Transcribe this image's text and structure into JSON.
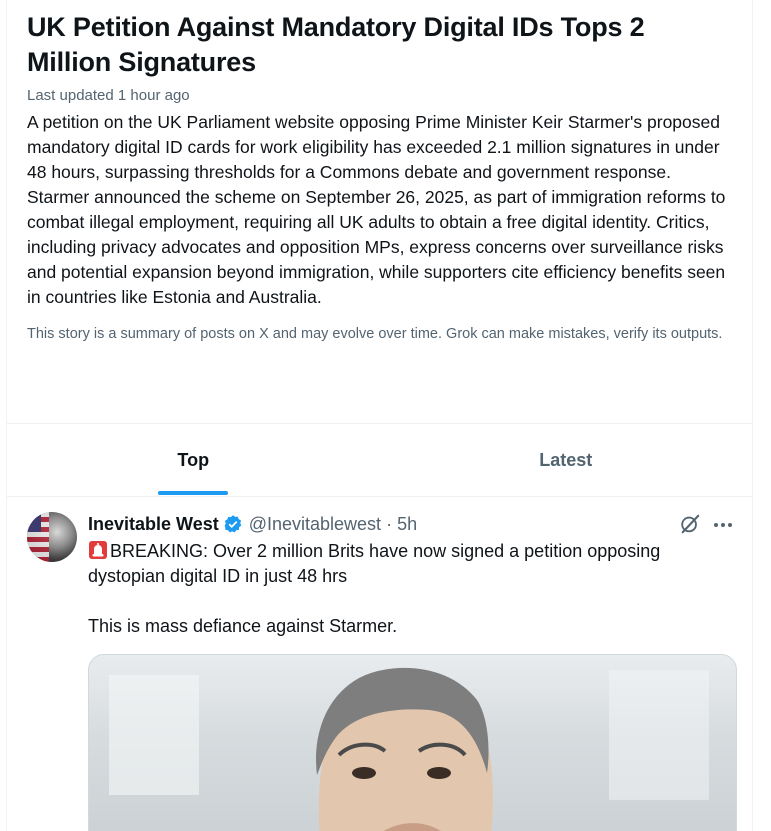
{
  "story": {
    "title": "UK Petition Against Mandatory Digital IDs Tops 2 Million Signatures",
    "updated": "Last updated 1 hour ago",
    "body": "A petition on the UK Parliament website opposing Prime Minister Keir Starmer's proposed mandatory digital ID cards for work eligibility has exceeded 2.1 million signatures in under 48 hours, surpassing thresholds for a Commons debate and government response. Starmer announced the scheme on September 26, 2025, as part of immigration reforms to combat illegal employment, requiring all UK adults to obtain a free digital identity. Critics, including privacy advocates and opposition MPs, express concerns over surveillance risks and potential expansion beyond immigration, while supporters cite efficiency benefits seen in countries like Estonia and Australia.",
    "disclaimer": "This story is a summary of posts on X and may evolve over time. Grok can make mistakes, verify its outputs."
  },
  "tabs": [
    {
      "label": "Top",
      "active": true
    },
    {
      "label": "Latest",
      "active": false
    }
  ],
  "post": {
    "author": "Inevitable West",
    "handle": "@Inevitablewest",
    "separator": "·",
    "time": "5h",
    "line1": "BREAKING: Over 2 million Brits have now signed a petition opposing dystopian digital ID in just 48 hrs",
    "line2": "This is mass defiance against Starmer.",
    "icons": {
      "emoji": "siren-icon",
      "verified": "verified-badge-icon",
      "grok": "grok-icon",
      "more": "more-icon"
    }
  },
  "colors": {
    "accent": "#1d9bf0",
    "text": "#0f1419",
    "secondary": "#536471",
    "border": "#eff3f4"
  }
}
